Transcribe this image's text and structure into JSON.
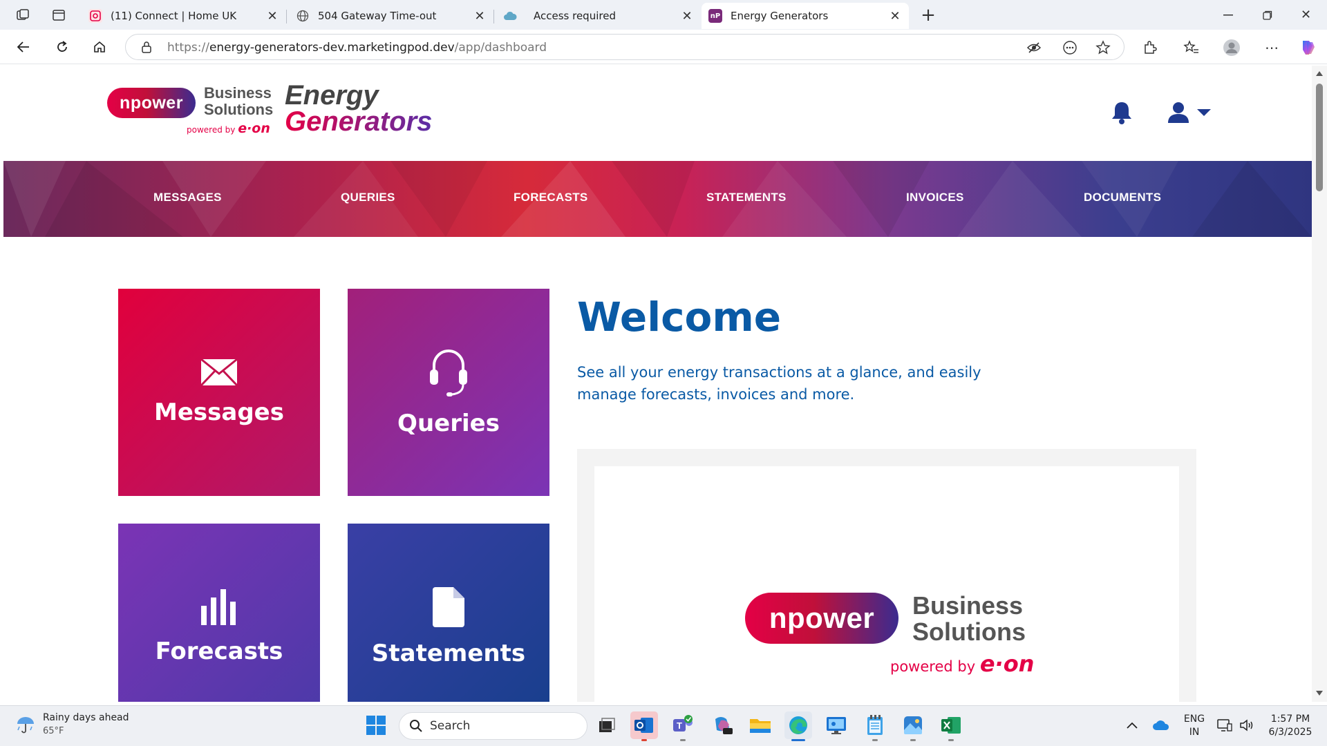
{
  "browser": {
    "tabs": [
      {
        "title": "(11) Connect | Home UK",
        "favicon": "connect-icon"
      },
      {
        "title": "504 Gateway Time-out",
        "favicon": "globe-icon"
      },
      {
        "title": "Access required",
        "favicon": "cloud-icon"
      },
      {
        "title": "Energy Generators",
        "favicon": "np-icon",
        "favicon_text": "nP",
        "active": true
      }
    ],
    "url_prefix": "https://",
    "url_host": "energy-generators-dev.marketingpod.dev",
    "url_path": "/app/dashboard"
  },
  "brand": {
    "npower": "npower",
    "business": "Business",
    "solutions": "Solutions",
    "powered_by": "powered by",
    "eon": "e·on",
    "product_line1": "Energy",
    "product_line2": "Generators"
  },
  "nav": {
    "items": [
      "MESSAGES",
      "QUERIES",
      "FORECASTS",
      "STATEMENTS",
      "INVOICES",
      "DOCUMENTS"
    ]
  },
  "tiles": [
    {
      "label": "Messages",
      "icon": "envelope-icon"
    },
    {
      "label": "Queries",
      "icon": "headset-icon"
    },
    {
      "label": "Forecasts",
      "icon": "bar-chart-icon"
    },
    {
      "label": "Statements",
      "icon": "document-icon"
    }
  ],
  "welcome": {
    "title": "Welcome",
    "text": "See all your energy transactions at a glance, and easily manage forecasts, invoices and more."
  },
  "taskbar": {
    "weather_title": "Rainy days ahead",
    "weather_temp": "65°F",
    "search_placeholder": "Search",
    "lang": "ENG",
    "region": "IN",
    "time": "1:57 PM",
    "date": "6/3/2025"
  },
  "colors": {
    "brand_red": "#e40046",
    "brand_blue": "#0a5aa5",
    "brand_navy": "#1f3a8f",
    "brand_purple": "#7a3ab5"
  }
}
